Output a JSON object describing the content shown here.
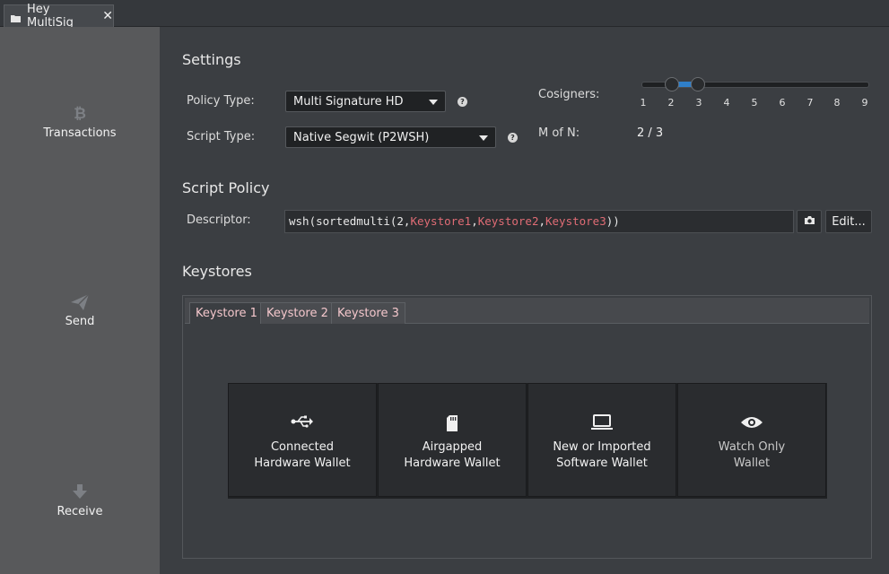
{
  "window_tab": {
    "title": "Hey MultiSig",
    "close_glyph": "✕",
    "icon": "folder-icon"
  },
  "sidebar": {
    "items": [
      {
        "label": "Transactions",
        "icon": "bitcoin-icon"
      },
      {
        "label": "Send",
        "icon": "send-icon"
      },
      {
        "label": "Receive",
        "icon": "download-icon"
      }
    ]
  },
  "settings": {
    "title": "Settings",
    "policy_type_label": "Policy Type:",
    "policy_type_value": "Multi Signature HD",
    "script_type_label": "Script Type:",
    "script_type_value": "Native Segwit (P2WSH)",
    "cosigners_label": "Cosigners:",
    "cosigners_ticks": [
      "1",
      "2",
      "3",
      "4",
      "5",
      "6",
      "7",
      "8",
      "9"
    ],
    "cosigners_low": 2,
    "cosigners_high": 3,
    "m_of_n_label": "M of N:",
    "m_of_n_value": "2 / 3",
    "help_glyph": "?"
  },
  "script_policy": {
    "title": "Script Policy",
    "descriptor_label": "Descriptor:",
    "descriptor_prefix": "wsh(sortedmulti(2,",
    "keystores": [
      "Keystore1",
      "Keystore2",
      "Keystore3"
    ],
    "separator": ",",
    "descriptor_suffix": "))",
    "edit_label": "Edit...",
    "camera_icon": "camera-icon"
  },
  "keystores": {
    "title": "Keystores",
    "tabs": [
      "Keystore 1",
      "Keystore 2",
      "Keystore 3"
    ],
    "active_tab": 0,
    "options": [
      {
        "line1": "Connected",
        "line2": "Hardware Wallet",
        "icon": "usb-icon"
      },
      {
        "line1": "Airgapped",
        "line2": "Hardware Wallet",
        "icon": "sd-card-icon"
      },
      {
        "line1": "New or Imported",
        "line2": "Software Wallet",
        "icon": "laptop-icon"
      },
      {
        "line1": "Watch Only",
        "line2": "Wallet",
        "icon": "eye-icon"
      }
    ]
  },
  "colors": {
    "background": "#3b3e42",
    "sidebar": "#58595b",
    "accent": "#2f7fc9",
    "keystore_text": "#e06c75"
  }
}
